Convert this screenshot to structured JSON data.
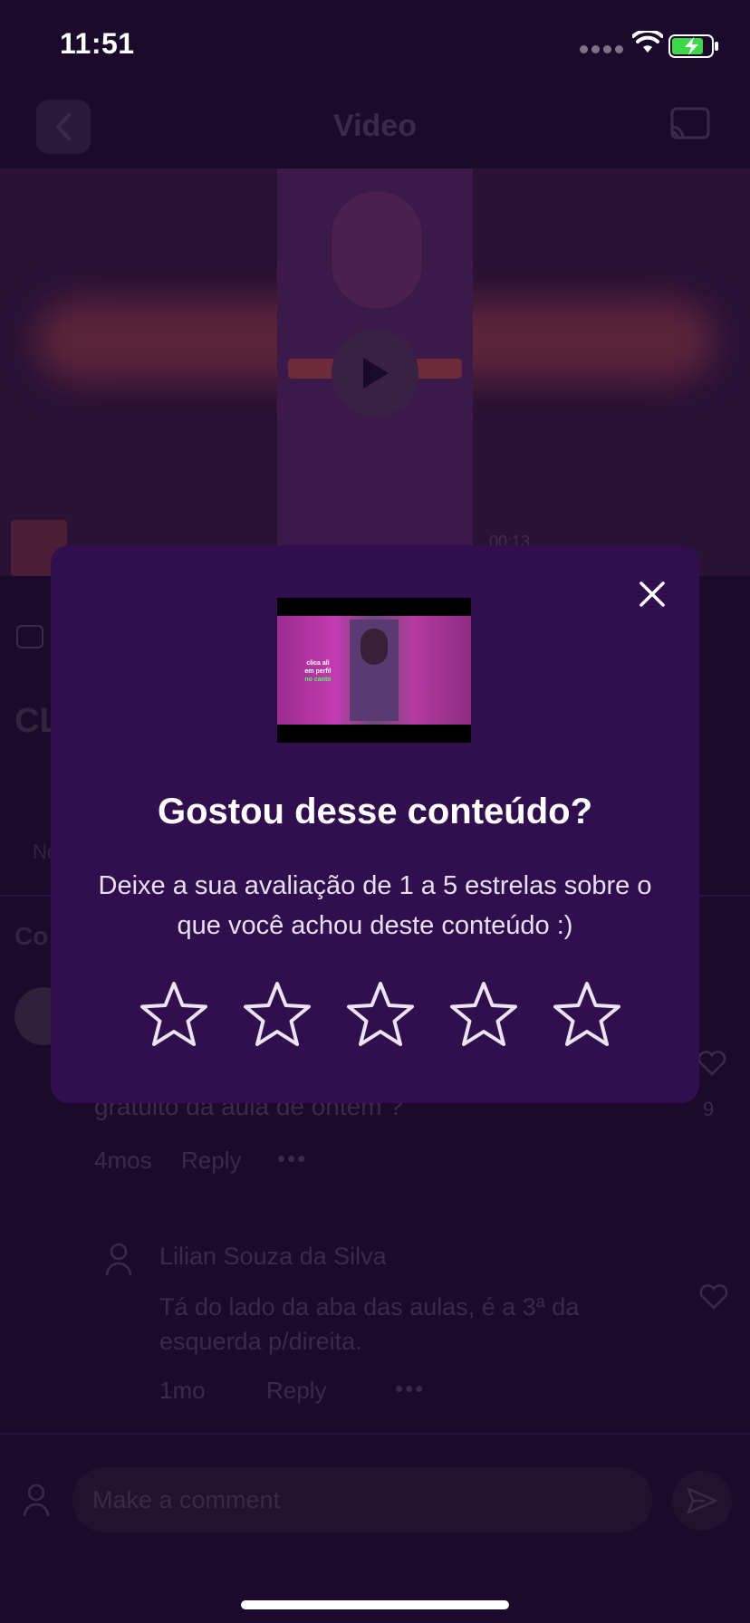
{
  "status_bar": {
    "time": "11:51"
  },
  "nav": {
    "title": "Video"
  },
  "video_overlay": {
    "time": "00:13",
    "thumbnail_text_line1": "clica ali",
    "thumbnail_text_line2": "em perfil",
    "thumbnail_text_line3": "no canto"
  },
  "background": {
    "heading_partial": "CL",
    "tab_partial": "No",
    "comments_partial": "Co"
  },
  "comments": [
    {
      "text_partial": "gratuito da aula de ontem ?",
      "age": "4mos",
      "reply_label": "Reply",
      "more": "•••",
      "like_count": "9"
    },
    {
      "author": "Lilian Souza da Silva",
      "text": "Tá do lado da aba das aulas, é a 3ª da esquerda p/direita.",
      "age": "1mo",
      "reply_label": "Reply",
      "more": "•••"
    }
  ],
  "comment_input": {
    "placeholder": "Make a comment"
  },
  "modal": {
    "title": "Gostou desse conteúdo?",
    "description": "Deixe a sua avaliação de 1 a 5 estrelas sobre o que você achou deste conteúdo :)",
    "rating": 0,
    "max_rating": 5
  },
  "colors": {
    "background": "#1c0a2c",
    "modal": "#310e4e",
    "accent_text": "#ffffff"
  }
}
